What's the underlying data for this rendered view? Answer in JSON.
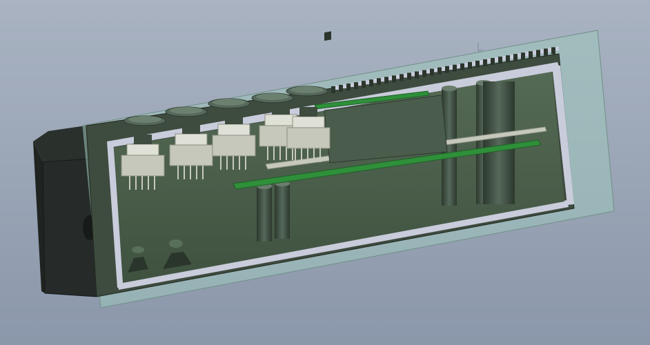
{
  "viewport": {
    "background_top": "#a9b3c2",
    "background_bottom": "#8b97aa"
  },
  "model": {
    "housing_color": "#3e4b3f",
    "housing_dark": "#262b29",
    "section_plane_color": "#9fc6bb",
    "section_cut_color": "#c9ccdb",
    "pcb_color": "#2f8f3a",
    "component_color": "#c5c8bb",
    "switch_count": 5,
    "standoff_count": 4
  }
}
